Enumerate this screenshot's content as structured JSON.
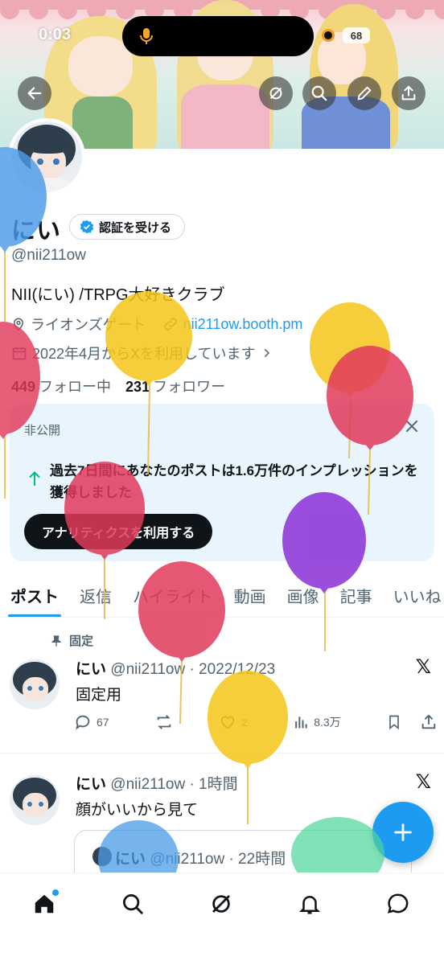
{
  "status_bar": {
    "time": "0:03",
    "battery": "68"
  },
  "banner": {
    "buttons": [
      "back-icon",
      "sync-icon",
      "search-icon",
      "edit-icon",
      "share-icon"
    ]
  },
  "profile": {
    "name": "にい",
    "verify_label": "認証を受ける",
    "handle": "@nii211ow",
    "bio": "NII(にい) /TRPG大好きクラブ",
    "location": "ライオンズゲート",
    "website": "nii211ow.booth.pm",
    "joined": "2022年4月からXを利用しています",
    "following_count": "449",
    "following_label": "フォロー中",
    "followers_count": "231",
    "followers_label": "フォロワー"
  },
  "private_card": {
    "label": "非公開",
    "message": "過去7日間にあなたのポストは1.6万件のインプレッションを獲得しました",
    "cta": "アナリティクスを利用する"
  },
  "tabs": [
    "ポスト",
    "返信",
    "ハイライト",
    "動画",
    "画像",
    "記事",
    "いいね"
  ],
  "posts": [
    {
      "pinned_label": "固定",
      "name": "にい",
      "handle_time": "@nii211ow · 2022/12/23",
      "text": "固定用",
      "replies": "67",
      "likes": "2",
      "views": "8.3万"
    },
    {
      "name": "にい",
      "handle_time": "@nii211ow · 1時間",
      "text": "顔がいいから見て",
      "quote": {
        "name": "にい",
        "handle_time": "@nii211ow · 22時間"
      }
    }
  ],
  "nav": [
    "home-icon",
    "search-icon",
    "grok-icon",
    "notifications-icon",
    "messages-icon"
  ],
  "colors": {
    "accent": "#1d9bf0",
    "text": "#0f1419",
    "muted": "#536471",
    "card_bg": "#e8f5fd"
  }
}
